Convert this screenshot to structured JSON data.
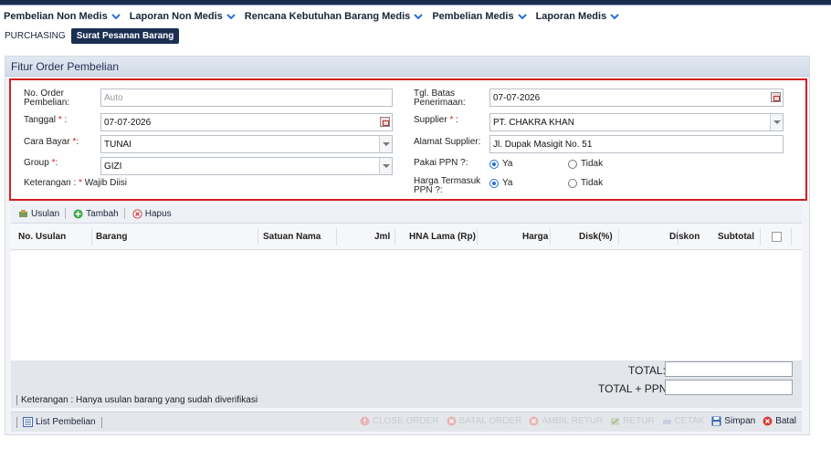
{
  "menu": [
    {
      "label": "Pembelian Non Medis"
    },
    {
      "label": "Laporan Non Medis"
    },
    {
      "label": "Rencana Kebutuhan Barang Medis"
    },
    {
      "label": "Pembelian Medis"
    },
    {
      "label": "Laporan Medis"
    }
  ],
  "breadcrumb": {
    "root": "PURCHASING",
    "active": "Surat Pesanan Barang"
  },
  "panel": {
    "title": "Fitur Order Pembelian"
  },
  "form": {
    "no_order": {
      "label": "No. Order Pembelian:",
      "placeholder": "Auto"
    },
    "tanggal": {
      "label": "Tanggal",
      "req": "*",
      "colon": ":",
      "value": "07-07-2026"
    },
    "cara_bayar": {
      "label": "Cara Bayar",
      "req": "*",
      "colon": ":",
      "value": "TUNAI"
    },
    "group": {
      "label": "Group",
      "req": "*",
      "colon": ":",
      "value": "GIZI"
    },
    "keterangan": {
      "prefix": "Keterangan :",
      "req": "*",
      "suffix": "Wajib Diisi"
    },
    "tgl_batas": {
      "label": "Tgl. Batas Penerimaan:",
      "value": "07-07-2026"
    },
    "supplier": {
      "label": "Supplier",
      "req": "*",
      "colon": ":",
      "value": "PT. CHAKRA KHAN"
    },
    "alamat": {
      "label": "Alamat Supplier:",
      "value": "Jl. Dupak Masigit No. 51"
    },
    "pakai_ppn": {
      "label": "Pakai PPN ?:",
      "yes": "Ya",
      "no": "Tidak",
      "selected": "Ya"
    },
    "harga_ppn": {
      "label": "Harga Termasuk PPN ?:",
      "yes": "Ya",
      "no": "Tidak",
      "selected": "Ya"
    }
  },
  "toolbar": {
    "usulan": "Usulan",
    "tambah": "Tambah",
    "hapus": "Hapus"
  },
  "grid": {
    "columns": [
      "No. Usulan",
      "Barang",
      "Satuan Nama",
      "Jml",
      "HNA Lama (Rp)",
      "Harga",
      "Disk(%)",
      "Diskon",
      "Subtotal"
    ],
    "rows": []
  },
  "totals": {
    "total_label": "TOTAL:",
    "total_ppn_label": "TOTAL + PPN:",
    "total": "",
    "total_ppn": ""
  },
  "note": "Keterangan : Hanya usulan barang yang sudah diverifikasi",
  "bottom": {
    "list": "List Pembelian",
    "close_order": "CLOSE ORDER",
    "batal_order": "BATAL ORDER",
    "ambil_retur": "AMBIL RETUR",
    "retur": "RETUR",
    "cetak": "CETAK",
    "simpan": "Simpan",
    "batal": "Batal"
  },
  "colors": {
    "accent": "#1b2f52",
    "required": "#d61e1e",
    "radio": "#2a6fd6"
  }
}
